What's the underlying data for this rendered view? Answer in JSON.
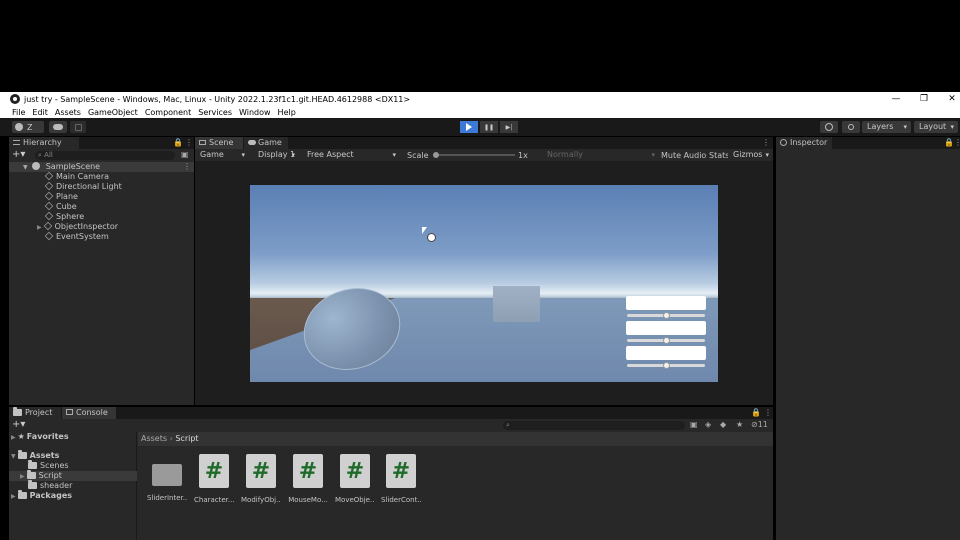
{
  "window": {
    "title": "just try - SampleScene - Windows, Mac, Linux - Unity 2022.1.23f1c1.git.HEAD.4612988 <DX11>",
    "controls": [
      "—",
      "❐",
      "✕"
    ]
  },
  "menu": [
    "File",
    "Edit",
    "Assets",
    "GameObject",
    "Component",
    "Services",
    "Window",
    "Help"
  ],
  "toolbar": {
    "account": "Z",
    "play": "▶",
    "pause": "❚❚",
    "step": "▶|",
    "layers": "Layers",
    "layout": "Layout"
  },
  "hierarchy": {
    "tab": "Hierarchy",
    "search_placeholder": "All",
    "scene": "SampleScene",
    "items": [
      "Main Camera",
      "Directional Light",
      "Plane",
      "Cube",
      "Sphere",
      "ObjectInspector",
      "EventSystem"
    ]
  },
  "center": {
    "tabs": [
      "Scene",
      "Game"
    ],
    "game_bar": {
      "mode": "Game",
      "display": "Display 1",
      "aspect": "Free Aspect",
      "scale_label": "Scale",
      "scale_value": "1x",
      "play_focus": "Normally",
      "mute": "Mute Audio",
      "stats": "Stats",
      "gizmos": "Gizmos"
    },
    "scale": 0.0
  },
  "inspector": {
    "tab": "Inspector"
  },
  "project": {
    "tabs": [
      "Project",
      "Console"
    ],
    "badge": "11",
    "tree": {
      "favorites": "Favorites",
      "assets": "Assets",
      "children": [
        "Scenes",
        "Script",
        "sheader"
      ],
      "packages": "Packages"
    },
    "breadcrumb": [
      "Assets",
      "Script"
    ],
    "files": [
      {
        "label": "SliderInter...",
        "type": "folder"
      },
      {
        "label": "Character...",
        "type": "script"
      },
      {
        "label": "ModifyObj...",
        "type": "script"
      },
      {
        "label": "MouseMo...",
        "type": "script"
      },
      {
        "label": "MoveObje...",
        "type": "script"
      },
      {
        "label": "SliderCont...",
        "type": "script"
      }
    ],
    "script_glyph": "#"
  },
  "colors": {
    "play_active": "#3c7ad6",
    "panel": "#282828",
    "toolbar": "#191919",
    "script_icon_glyph": "#1f6b2a"
  }
}
